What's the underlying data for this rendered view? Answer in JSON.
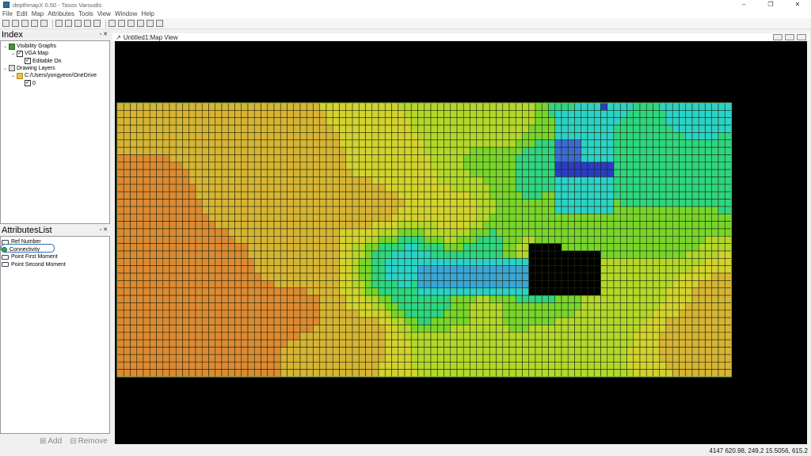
{
  "window": {
    "title": "depthmapX 0.50 - Tasos Varoudis",
    "controls": [
      "–",
      "❐",
      "✕"
    ]
  },
  "menu": [
    "File",
    "Edit",
    "Map",
    "Attributes",
    "Tools",
    "View",
    "Window",
    "Help"
  ],
  "toolbar_icons": [
    "new-icon",
    "open-icon",
    "save-icon",
    "print-icon",
    "import-icon",
    "export-icon",
    "grid-icon",
    "select-icon",
    "pan-icon",
    "zoom-icon",
    "fill-icon",
    "line-icon",
    "isovist-icon",
    "axial-icon",
    "step-icon",
    "join-icon"
  ],
  "index_panel": {
    "title": "Index",
    "buttons": "▫ ✕",
    "tree": [
      {
        "label": "Visibility Graphs",
        "indent": 0,
        "expander": "⌄",
        "icon": "graph"
      },
      {
        "label": "VGA Map",
        "indent": 1,
        "expander": "⌄",
        "icon": "check",
        "mark": "✓"
      },
      {
        "label": "Editable On",
        "indent": 2,
        "expander": "",
        "icon": "check",
        "mark": "✓"
      },
      {
        "label": "Drawing Layers",
        "indent": 0,
        "expander": "⌄",
        "icon": "layers"
      },
      {
        "label": "C:/Users/yongyeon/OneDrive",
        "indent": 1,
        "expander": "⌄",
        "icon": "folder"
      },
      {
        "label": "0",
        "indent": 2,
        "expander": "",
        "icon": "check",
        "mark": "✓"
      }
    ]
  },
  "attributes_panel": {
    "title": "AttributesList",
    "buttons": "▫ ✕",
    "items": [
      {
        "label": "Ref Number",
        "active": false
      },
      {
        "label": "Connectivity",
        "active": true
      },
      {
        "label": "Point First Moment",
        "active": false
      },
      {
        "label": "Point Second Moment",
        "active": false
      }
    ],
    "add_label": "Add",
    "remove_label": "Remove"
  },
  "map_window": {
    "title": "Untitled1:Map View",
    "colors": {
      "red": "#dc3a33",
      "orange": "#de8a32",
      "yellow_orange": "#d7b433",
      "yellow": "#d3d22e",
      "yellow_green": "#b4d72a",
      "green": "#78d62a",
      "sea_green": "#2ed680",
      "cyan": "#2bd2c7",
      "light_blue": "#3aa6d8",
      "blue": "#3a6bd8",
      "deep_blue": "#2a3cc8",
      "grid_line": "#1e2a10",
      "background": "#000000"
    }
  },
  "status": {
    "coordinates": "4147  620.98,  249.2  15.5056,  615.2"
  }
}
